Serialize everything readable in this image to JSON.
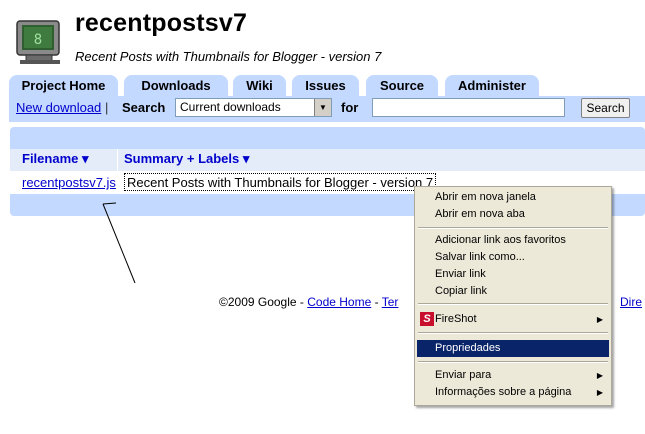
{
  "project": {
    "title": "recentpostsv7",
    "summary": "Recent Posts with Thumbnails for Blogger - version 7"
  },
  "tabs": [
    {
      "label": "Project Home"
    },
    {
      "label": "Downloads"
    },
    {
      "label": "Wiki"
    },
    {
      "label": "Issues"
    },
    {
      "label": "Source"
    },
    {
      "label": "Administer"
    }
  ],
  "subbar": {
    "new_download": "New download",
    "separator": "|",
    "search_label": "Search",
    "search_scope": "Current downloads",
    "for_label": "for",
    "search_value": "",
    "search_button": "Search"
  },
  "table": {
    "headers": [
      "Filename ▾",
      "Summary + Labels ▾"
    ],
    "rows": [
      {
        "filename": "recentpostsv7.js",
        "summary": "Recent Posts with Thumbnails for Blogger - version 7"
      }
    ]
  },
  "footer": {
    "copyright": "©2009 Google - ",
    "code_home": "Code Home",
    "sep": " - ",
    "terms": "Ter",
    "direct": "Dire"
  },
  "context_menu": {
    "items": [
      "Abrir em nova janela",
      "Abrir em nova aba",
      "Adicionar link aos favoritos",
      "Salvar link como...",
      "Enviar link",
      "Copiar link",
      "FireShot",
      "Propriedades",
      "Enviar para",
      "Informações sobre a página"
    ],
    "fireshot_icon_letter": "S",
    "selected": "Propriedades"
  }
}
